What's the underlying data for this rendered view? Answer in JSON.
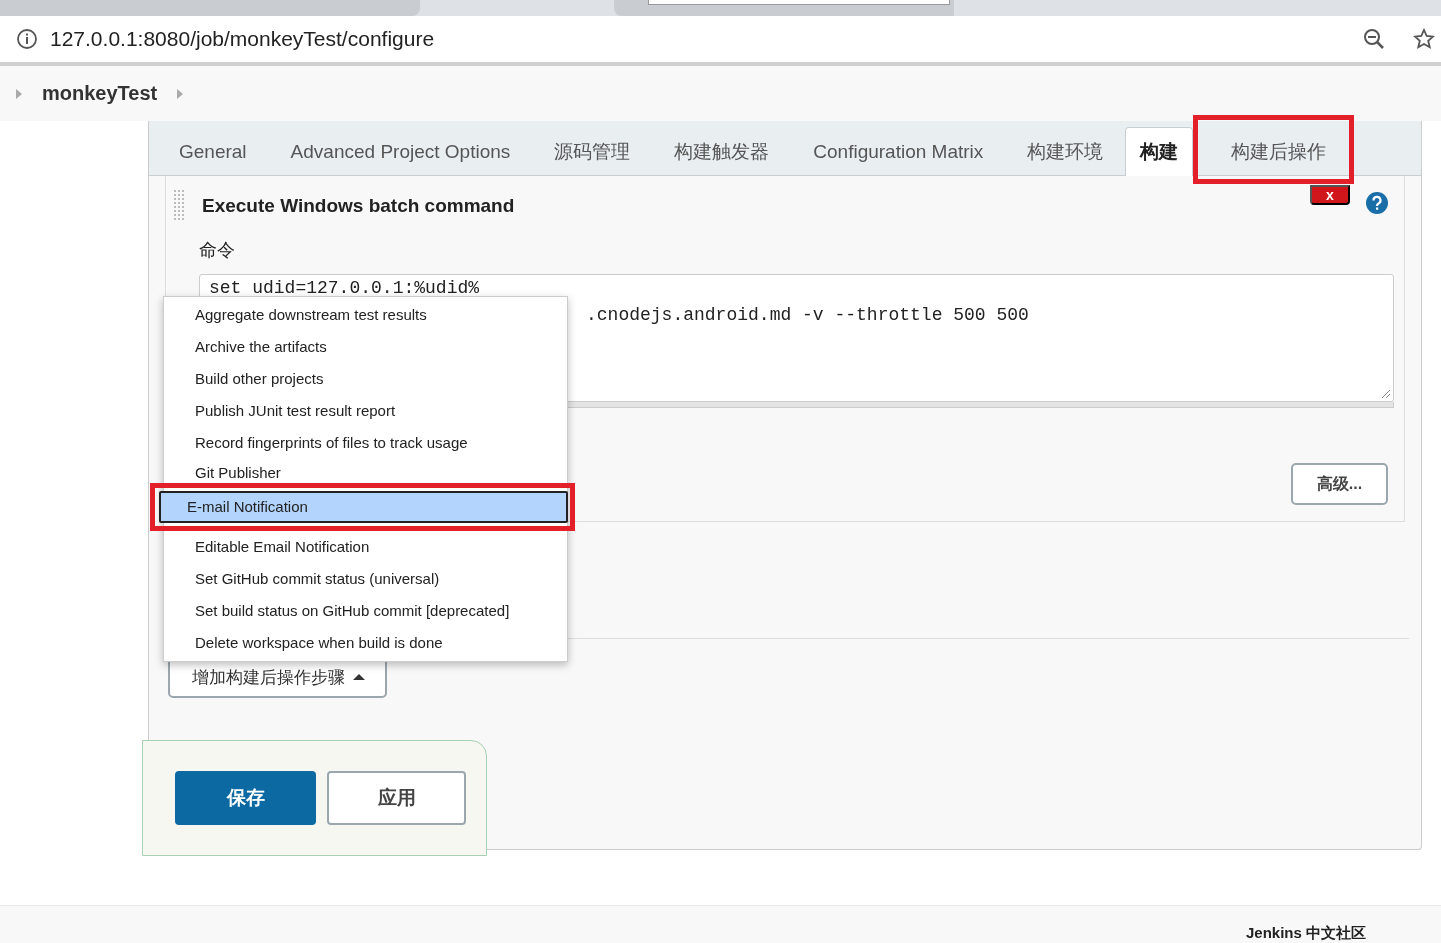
{
  "browser": {
    "url": "127.0.0.1:8080/job/monkeyTest/configure"
  },
  "breadcrumb": {
    "job": "monkeyTest"
  },
  "tabs": [
    {
      "label": "General",
      "selected": false,
      "highlighted": false
    },
    {
      "label": "Advanced Project Options",
      "selected": false,
      "highlighted": false
    },
    {
      "label": "源码管理",
      "selected": false,
      "highlighted": false
    },
    {
      "label": "构建触发器",
      "selected": false,
      "highlighted": false
    },
    {
      "label": "Configuration Matrix",
      "selected": false,
      "highlighted": false
    },
    {
      "label": "构建环境",
      "selected": false,
      "highlighted": false
    },
    {
      "label": "构建",
      "selected": true,
      "highlighted": false
    },
    {
      "label": "构建后操作",
      "selected": false,
      "highlighted": true
    }
  ],
  "build_step": {
    "title": "Execute Windows batch command",
    "delete_label": "x",
    "command_label": "命令",
    "command_lines": [
      "set udid=127.0.0.1:%udid%",
      ".cnodejs.android.md -v --throttle 500 500"
    ],
    "advanced_button": "高级..."
  },
  "post_build_menu": {
    "items": [
      {
        "label": "Aggregate downstream test results",
        "selected": false,
        "highlighted": false
      },
      {
        "label": "Archive the artifacts",
        "selected": false,
        "highlighted": false
      },
      {
        "label": "Build other projects",
        "selected": false,
        "highlighted": false
      },
      {
        "label": "Publish JUnit test result report",
        "selected": false,
        "highlighted": false
      },
      {
        "label": "Record fingerprints of files to track usage",
        "selected": false,
        "highlighted": false
      },
      {
        "label": "Git Publisher",
        "selected": false,
        "highlighted": false
      },
      {
        "label": "E-mail Notification",
        "selected": true,
        "highlighted": true
      },
      {
        "label": "Editable Email Notification",
        "selected": false,
        "highlighted": false
      },
      {
        "label": "Set GitHub commit status (universal)",
        "selected": false,
        "highlighted": false
      },
      {
        "label": "Set build status on GitHub commit [deprecated]",
        "selected": false,
        "highlighted": false
      },
      {
        "label": "Delete workspace when build is done",
        "selected": false,
        "highlighted": false
      }
    ]
  },
  "add_post_build_button": "增加构建后操作步骤",
  "save_button": "保存",
  "apply_button": "应用",
  "footer": "Jenkins 中文社区"
}
